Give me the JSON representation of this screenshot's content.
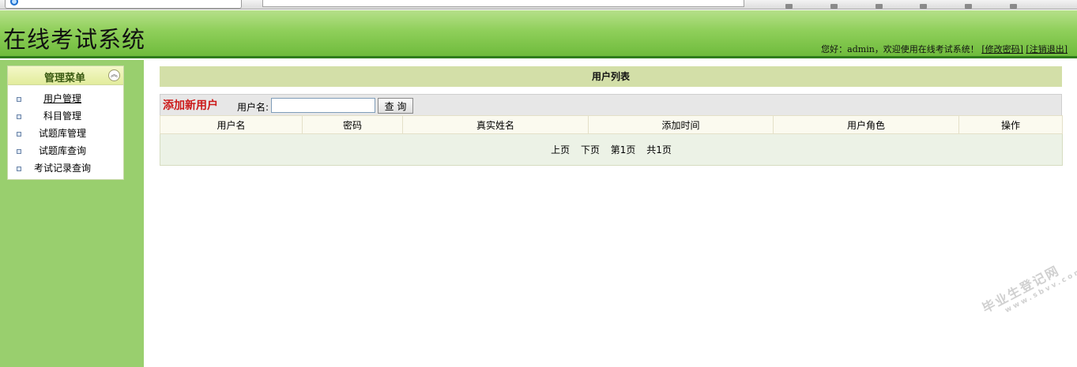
{
  "header": {
    "site_title": "在线考试系统",
    "greeting_prefix": "您好：",
    "username": "admin",
    "greeting_suffix": "，欢迎使用在线考试系统！",
    "change_password": "[修改密码]",
    "logout": "[注销退出]"
  },
  "sidebar": {
    "title": "管理菜单",
    "collapse_icon": "double-chevron-up-icon",
    "items": [
      {
        "label": "用户管理"
      },
      {
        "label": "科目管理"
      },
      {
        "label": "试题库管理"
      },
      {
        "label": "试题库查询"
      },
      {
        "label": "考试记录查询"
      }
    ]
  },
  "main": {
    "list_title": "用户列表",
    "add_user": "添加新用户",
    "search_label": "用户名:",
    "search_value": "",
    "search_button": "查 询",
    "columns": [
      "用户名",
      "密码",
      "真实姓名",
      "添加时间",
      "用户角色",
      "操作"
    ],
    "pager": {
      "prev": "上页",
      "next": "下页",
      "current": "第1页",
      "total": "共1页"
    }
  },
  "watermark": {
    "text": "毕业生登记网",
    "url": "www.sbvv.com"
  },
  "colors": {
    "header_green": "#8fcf5a",
    "sidebar_green": "#99cf6e",
    "add_user_red": "#cc1a1a",
    "title_bar": "#d3dfa8"
  }
}
